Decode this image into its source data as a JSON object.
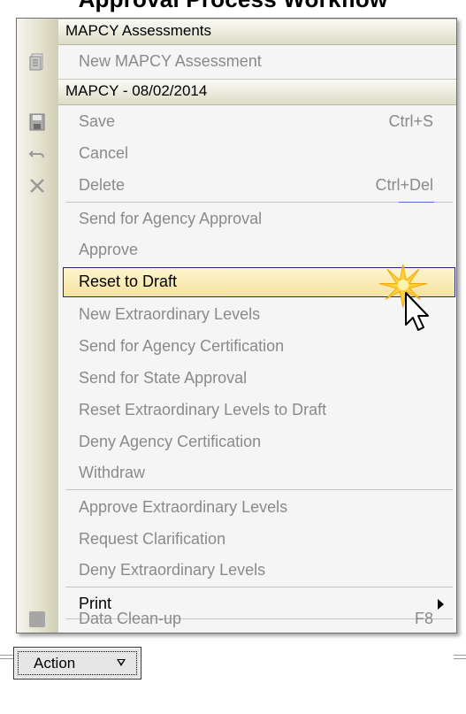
{
  "heading": "Approval Process Workflow",
  "menu": {
    "sections": [
      {
        "header": "MAPCY Assessments"
      },
      {
        "header": "MAPCY - 08/02/2014"
      }
    ],
    "items": {
      "new_assessment": {
        "label": "New MAPCY Assessment",
        "icon": "new-document-icon"
      },
      "save": {
        "label": "Save",
        "shortcut": "Ctrl+S",
        "icon": "save-disk-icon"
      },
      "cancel": {
        "label": "Cancel",
        "icon": "undo-icon"
      },
      "delete": {
        "label": "Delete",
        "shortcut": "Ctrl+Del",
        "icon": "delete-x-icon"
      },
      "send_agency_approval": {
        "label": "Send for Agency Approval"
      },
      "approve": {
        "label": "Approve"
      },
      "reset_to_draft": {
        "label": "Reset to Draft"
      },
      "new_extraordinary_levels": {
        "label": "New Extraordinary Levels"
      },
      "send_agency_certification": {
        "label": "Send for Agency Certification"
      },
      "send_state_approval": {
        "label": "Send for State Approval"
      },
      "reset_extraordinary_to_draft": {
        "label": "Reset Extraordinary Levels to Draft"
      },
      "deny_agency_certification": {
        "label": "Deny Agency Certification"
      },
      "withdraw": {
        "label": "Withdraw"
      },
      "approve_extraordinary_levels": {
        "label": "Approve Extraordinary Levels"
      },
      "request_clarification": {
        "label": "Request Clarification"
      },
      "deny_extraordinary_levels": {
        "label": "Deny Extraordinary Levels"
      },
      "print": {
        "label": "Print"
      },
      "data_cleanup": {
        "label": "Data Clean-up",
        "shortcut": "F8",
        "icon": "cleanup-square-icon"
      }
    },
    "highlighted": "Reset to Draft"
  },
  "action_button": {
    "label": "Action"
  },
  "colors": {
    "highlight_border": "#1c2c7a",
    "highlight_fill": "#f7e3a0",
    "disabled_text": "#8a8a8a",
    "gutter": "#d0ceb4"
  }
}
